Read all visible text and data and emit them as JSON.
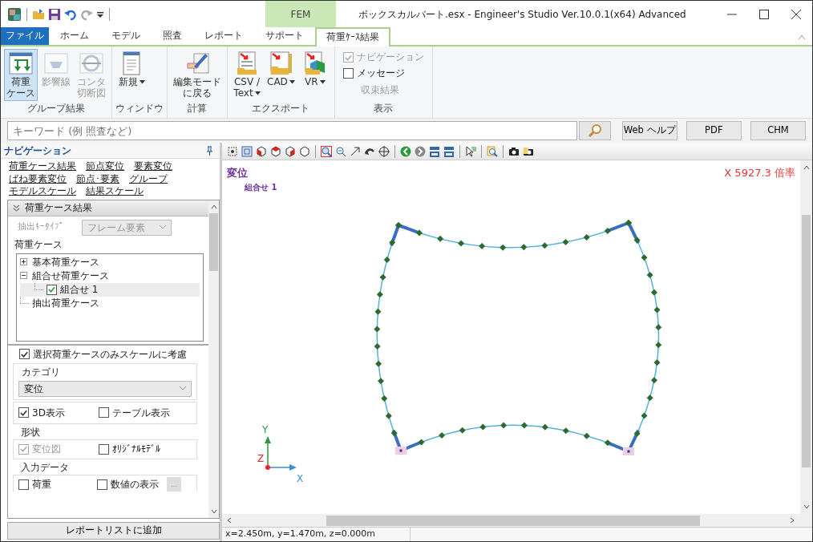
{
  "window": {
    "title": "ボックスカルバート.esx - Engineer's Studio Ver.10.0.1(x64) Advanced",
    "context_tab": "FEM"
  },
  "ribbon_tabs": [
    {
      "label": "ファイル",
      "kind": "file",
      "selected": false
    },
    {
      "label": "ホーム",
      "kind": "tab",
      "selected": false
    },
    {
      "label": "モデル",
      "kind": "tab",
      "selected": false
    },
    {
      "label": "照査",
      "kind": "tab",
      "selected": false
    },
    {
      "label": "レポート",
      "kind": "tab",
      "selected": false
    },
    {
      "label": "サポート",
      "kind": "tab",
      "selected": false
    },
    {
      "label": "荷重ｹｰｽ結果",
      "kind": "tab",
      "selected": true
    }
  ],
  "ribbon_groups": [
    {
      "label": "グループ結果",
      "items": [
        {
          "kind": "button",
          "lines": [
            "荷重",
            "ケース"
          ],
          "selected": true,
          "disabled": false,
          "dropdown": false
        },
        {
          "kind": "button",
          "lines": [
            "影響線"
          ],
          "selected": false,
          "disabled": true,
          "dropdown": false
        },
        {
          "kind": "button",
          "lines": [
            "コンタ",
            "切断図"
          ],
          "selected": false,
          "disabled": true,
          "dropdown": false
        }
      ]
    },
    {
      "label": "ウィンドウ",
      "items": [
        {
          "kind": "button",
          "lines": [
            "新規"
          ],
          "selected": false,
          "disabled": false,
          "dropdown": true
        }
      ]
    },
    {
      "label": "計算",
      "items": [
        {
          "kind": "button",
          "lines": [
            "編集モード",
            "に戻る"
          ],
          "selected": false,
          "disabled": false,
          "dropdown": false
        }
      ]
    },
    {
      "label": "エクスポート",
      "items": [
        {
          "kind": "button",
          "lines": [
            "CSV /",
            "Text"
          ],
          "selected": false,
          "disabled": false,
          "dropdown": true
        },
        {
          "kind": "button",
          "lines": [
            "CAD"
          ],
          "selected": false,
          "disabled": false,
          "dropdown": true
        },
        {
          "kind": "button",
          "lines": [
            "VR"
          ],
          "selected": false,
          "disabled": false,
          "dropdown": true
        }
      ]
    },
    {
      "label": "表示",
      "items": [
        {
          "kind": "check",
          "label": "ナビゲーション",
          "checked": true,
          "disabled": true
        },
        {
          "kind": "check",
          "label": "メッセージ",
          "checked": false,
          "disabled": false
        },
        {
          "kind": "text",
          "label": "収束結果",
          "disabled": true
        }
      ]
    }
  ],
  "search": {
    "placeholder": "キーワード (例 照査など)"
  },
  "help_buttons": [
    "Web ヘルプ",
    "PDF",
    "CHM"
  ],
  "navigation": {
    "title": "ナビゲーション",
    "links": [
      "荷重ケース結果",
      "節点変位",
      "要素変位",
      "ばね要素変位",
      "節点･要素",
      "グループ",
      "モデルスケール",
      "結果スケール"
    ],
    "section": {
      "title": "荷重ケース結果",
      "expanded": true
    },
    "key_type": {
      "label": "抽出ｷｰﾀｲﾌﾟ",
      "value": "フレーム要素",
      "disabled": true
    },
    "load_case_label": "荷重ケース",
    "tree": [
      {
        "label": "基本荷重ケース",
        "expanded": false
      },
      {
        "label": "組合せ荷重ケース",
        "expanded": true,
        "children": [
          {
            "label": "組合せ 1",
            "checked": true,
            "selected": true
          }
        ]
      },
      {
        "label": "抽出荷重ケース"
      }
    ],
    "scale_option": {
      "label": "選択荷重ケースのみスケールに考慮",
      "checked": true
    },
    "category": {
      "legend": "カテゴリ",
      "value": "変位"
    },
    "view_options": [
      {
        "label": "3D表示",
        "checked": true,
        "disabled": false
      },
      {
        "label": "テーブル表示",
        "checked": false,
        "disabled": false
      }
    ],
    "shape": {
      "legend": "形状",
      "options": [
        {
          "label": "変位図",
          "checked": true,
          "disabled": true
        },
        {
          "label": "ｵﾘｼﾞﾅﾙﾓﾃﾞﾙ",
          "checked": false,
          "disabled": false
        }
      ]
    },
    "input_data": {
      "legend": "入力データ",
      "options": [
        {
          "label": "荷重",
          "checked": false,
          "disabled": false
        },
        {
          "label": "数値の表示",
          "checked": false,
          "disabled": false
        }
      ],
      "more_button": {
        "label": "...",
        "disabled": true
      }
    },
    "add_button": "レポートリストに追加"
  },
  "viewport": {
    "title": "変位",
    "subtitle": "組合せ 1",
    "scale": "X 5927.3 倍率",
    "axes": [
      "Y",
      "Z",
      "X"
    ]
  },
  "status_bar": {
    "coordinates": "x=2.450m, y=1.470m, z=0.000m"
  }
}
